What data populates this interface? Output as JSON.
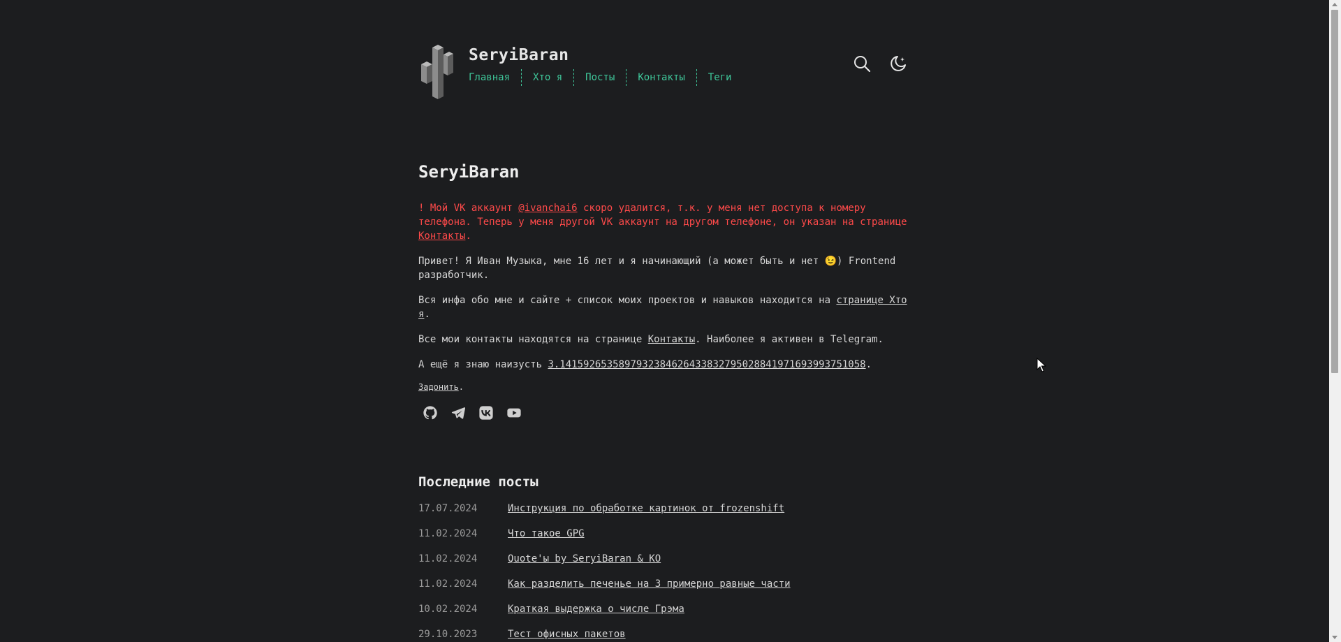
{
  "header": {
    "site_title": "SeryiBaran",
    "nav": [
      "Главная",
      "Хто я",
      "Посты",
      "Контакты",
      "Теги"
    ],
    "icons": [
      "search-icon",
      "theme-toggle-icon"
    ]
  },
  "main": {
    "title": "SeryiBaran",
    "alert": {
      "p1": "! Мой VK аккаунт ",
      "link1": "@ivanchai6",
      "p2": " скоро удалится, т.к. у меня нет доступа к номеру телефона. Теперь у меня другой VK аккаунт на другом телефоне, он указан на странице ",
      "link2": "Контакты",
      "p3": "."
    },
    "intro": "Привет! Я Иван Музыка, мне 16 лет и я начинающий (а может быть и нет 😉) Frontend разработчик.",
    "about": {
      "p1": "Вся инфа обо мне и сайте + список моих проектов и навыков находится на ",
      "link": "странице Хто я",
      "p2": "."
    },
    "contacts": {
      "p1": "Все мои контакты находятся на странице ",
      "link": "Контакты",
      "p2": ". Наиболее я активен в Telegram."
    },
    "pi": {
      "p1": "А ещё я знаю наизусть ",
      "link": "3.14159265358979323846264338327950288419716939937510​58",
      "p2": "."
    },
    "donate": {
      "link": "Задонить",
      "p2": "."
    },
    "socials": [
      "github-icon",
      "telegram-icon",
      "vk-icon",
      "youtube-icon"
    ]
  },
  "posts": {
    "title": "Последние посты",
    "items": [
      {
        "date": "17.07.2024",
        "title": "Инструкция по обработке картинок от frozenshift"
      },
      {
        "date": "11.02.2024",
        "title": "Что такое GPG"
      },
      {
        "date": "11.02.2024",
        "title": "Quote'ы by SeryiBaran & KO"
      },
      {
        "date": "11.02.2024",
        "title": "Как разделить печенье на 3 примерно равные части"
      },
      {
        "date": "10.02.2024",
        "title": "Краткая выдержка о числе Грэма"
      },
      {
        "date": "29.10.2023",
        "title": "Тест офисных пакетов"
      }
    ]
  }
}
